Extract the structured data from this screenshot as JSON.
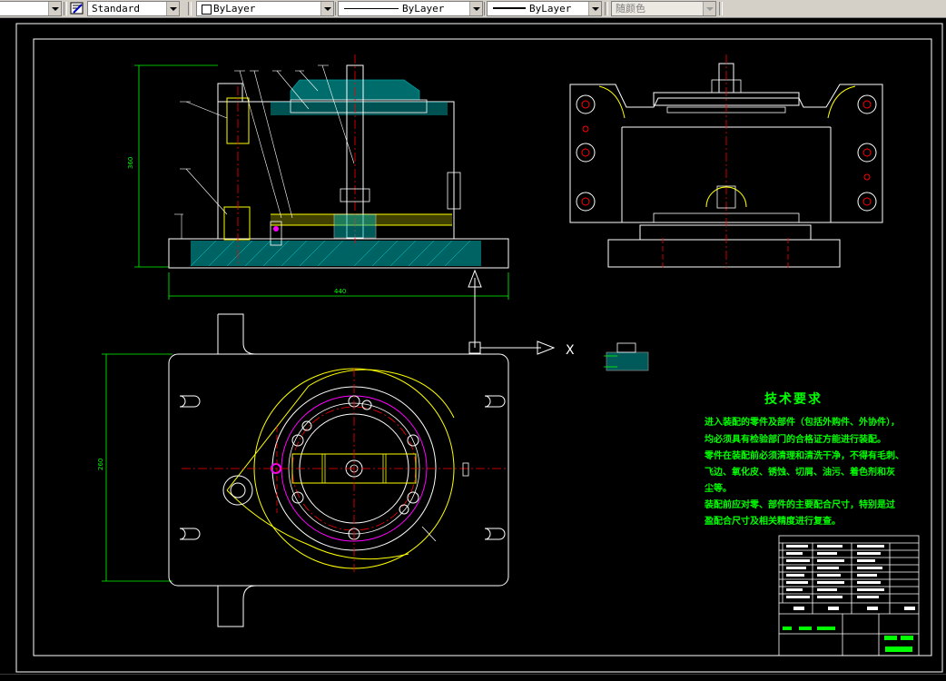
{
  "toolbar": {
    "text_style": "Standard",
    "layer": "ByLayer",
    "linetype": "ByLayer",
    "lineweight": "ByLayer",
    "plot_style": "随颜色"
  },
  "drawing": {
    "ucs_x_label": "X",
    "tech_requirements": {
      "title": "技术要求",
      "lines": [
        "进入装配的零件及部件（包括外购件、外协件），",
        "均必须具有检验部门的合格证方能进行装配。",
        "零件在装配前必须清理和清洗干净，不得有毛刺、",
        "飞边、氧化皮、锈蚀、切屑、油污、着色剂和灰",
        "尘等。",
        "装配前应对零、部件的主要配合尺寸，特别是过",
        "盈配合尺寸及相关精度进行复查。"
      ]
    }
  },
  "colors": {
    "frame": "#ffffff",
    "part_outline": "#ffffff",
    "yellow": "#ffff00",
    "cyan": "#00ffff",
    "red": "#ff0000",
    "green": "#00ff00",
    "magenta": "#ff00ff"
  }
}
